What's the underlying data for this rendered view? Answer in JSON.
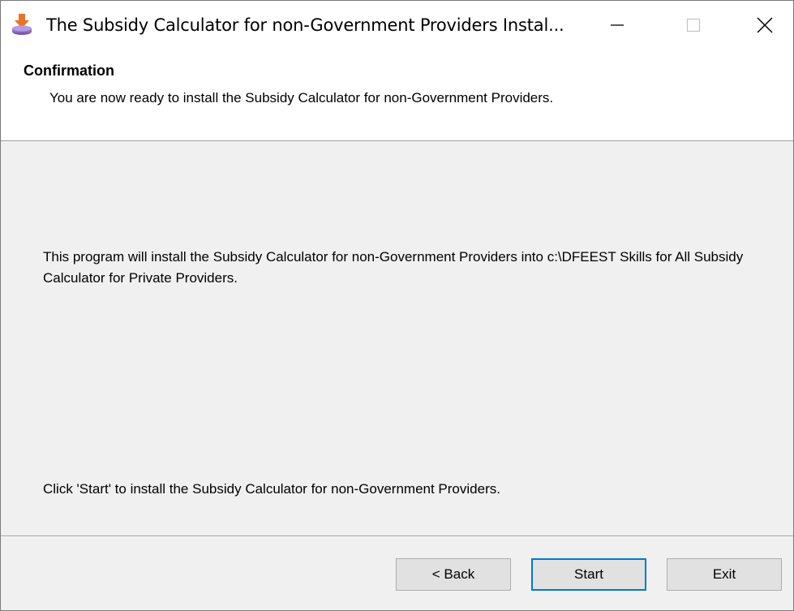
{
  "window": {
    "title": "The Subsidy Calculator for non-Government Providers Instal...",
    "app_icon": "installer-icon",
    "controls": {
      "minimize_icon": "minimize-icon",
      "maximize_icon": "maximize-icon",
      "close_icon": "close-icon"
    }
  },
  "header": {
    "title": "Confirmation",
    "description": "You are now ready to install the Subsidy Calculator for non-Government Providers."
  },
  "content": {
    "install_info": "This program will install the Subsidy Calculator for non-Government Providers into c:\\DFEEST Skills for All Subsidy Calculator for Private Providers.",
    "instruction": "Click 'Start' to install the Subsidy Calculator for non-Government Providers."
  },
  "buttons": {
    "back_label": "< Back",
    "start_label": "Start",
    "exit_label": "Exit"
  },
  "colors": {
    "accent": "#0078d7",
    "panel_background": "#f0f0f0",
    "header_background": "#ffffff",
    "button_face": "#e1e1e1"
  }
}
